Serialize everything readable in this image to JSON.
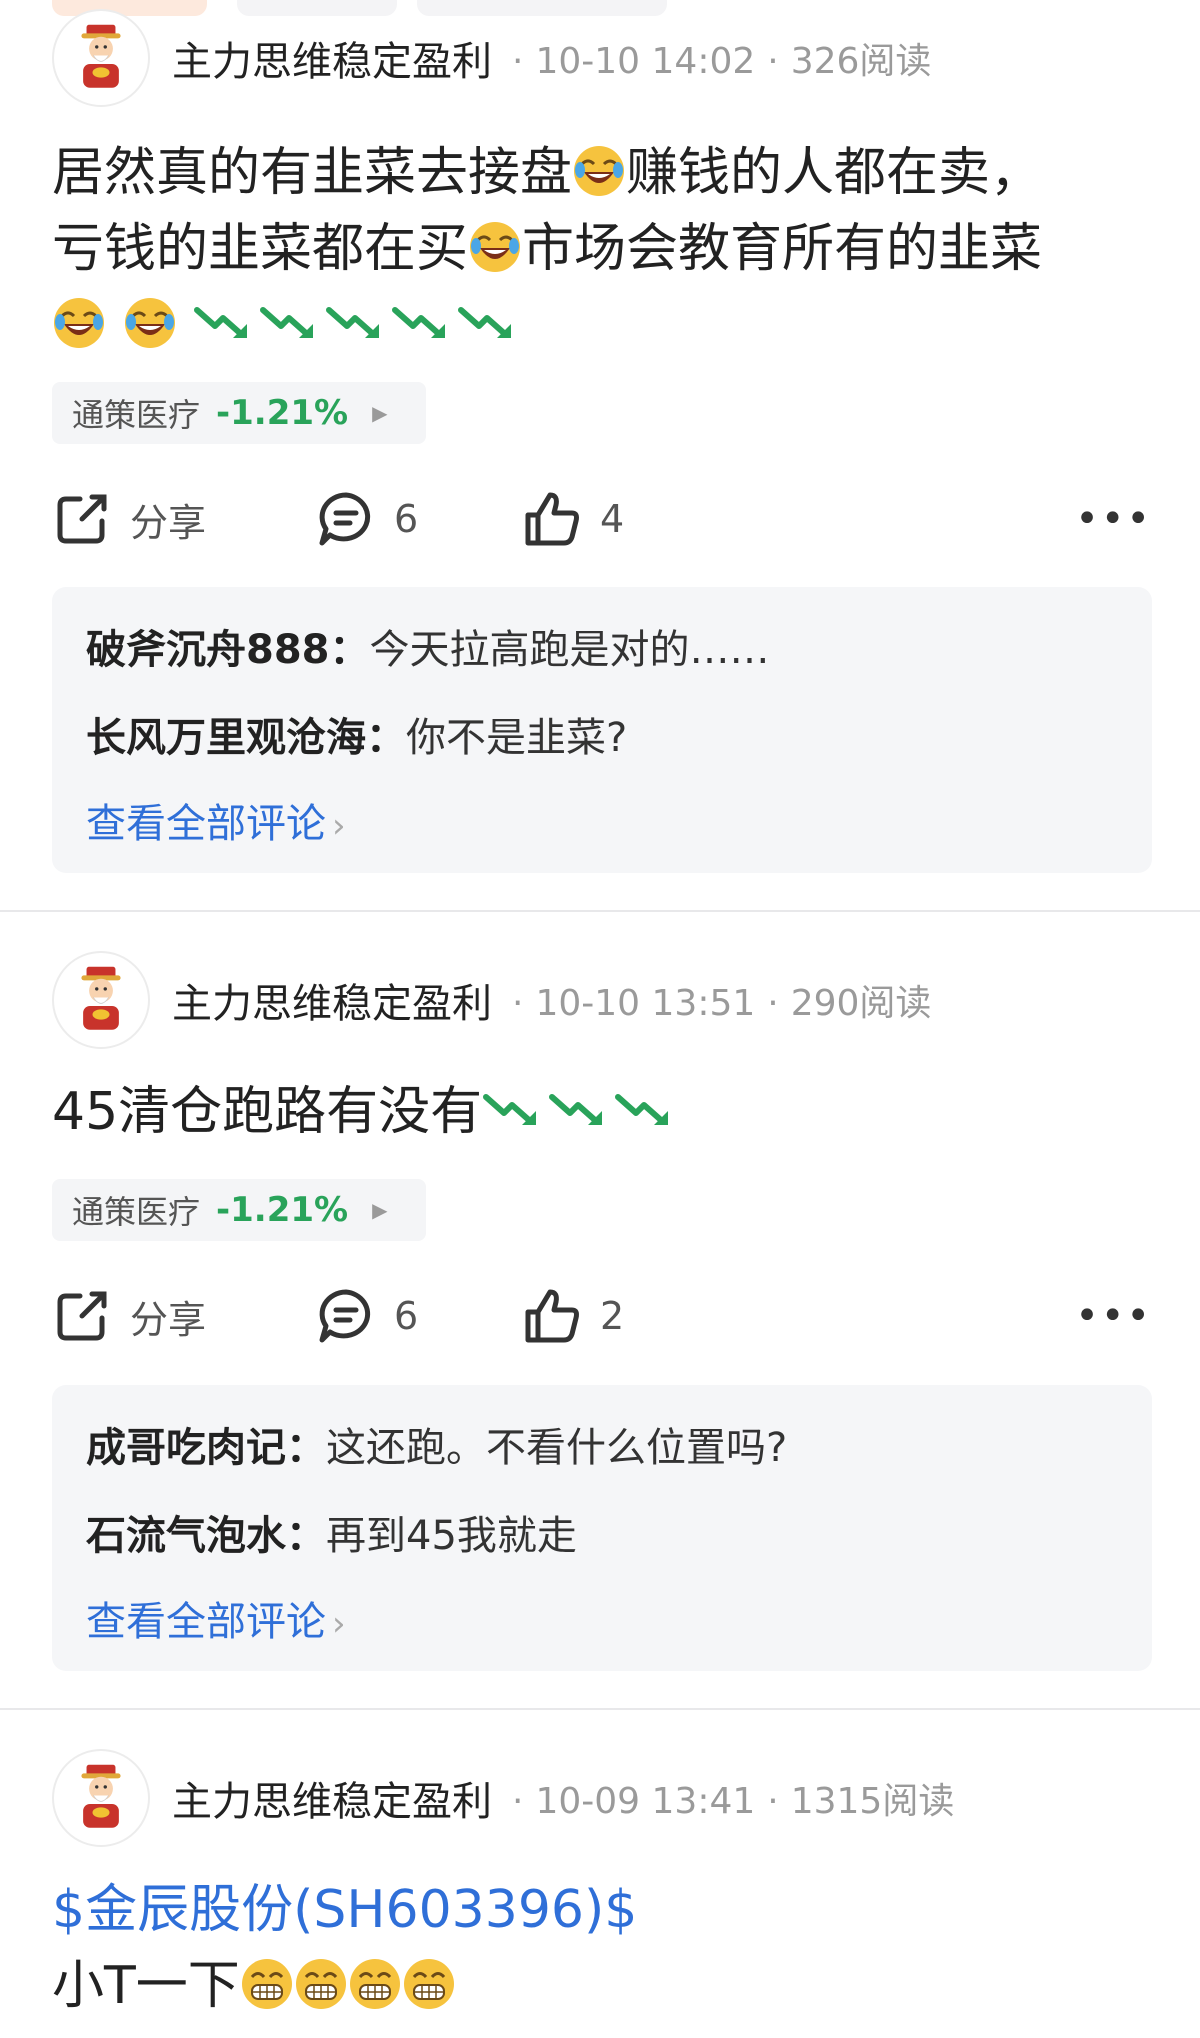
{
  "colors": {
    "link": "#2f6fd8",
    "down": "#29a35a",
    "meta": "#9a9a9a"
  },
  "posts": [
    {
      "author": "主力思维稳定盈利",
      "date": "10-10 14:02",
      "reads": "326阅读",
      "body_parts": [
        "居然真的有韭菜去接盘",
        "赚钱的人都在卖，",
        "亏钱的韭菜都在买",
        "市场会教育所有的韭菜"
      ],
      "stock": {
        "name": "通策医疗",
        "change": "-1.21%"
      },
      "share_label": "分享",
      "comment_count": "6",
      "like_count": "4",
      "comments": [
        {
          "name": "破斧沉舟888",
          "text": "今天拉高跑是对的……"
        },
        {
          "name": "长风万里观沧海",
          "text": "你不是韭菜?"
        }
      ],
      "view_all": "查看全部评论"
    },
    {
      "author": "主力思维稳定盈利",
      "date": "10-10 13:51",
      "reads": "290阅读",
      "body_text": "45清仓跑路有没有",
      "stock": {
        "name": "通策医疗",
        "change": "-1.21%"
      },
      "share_label": "分享",
      "comment_count": "6",
      "like_count": "2",
      "comments": [
        {
          "name": "成哥吃肉记",
          "text": "这还跑。不看什么位置吗?"
        },
        {
          "name": "石流气泡水",
          "text": "再到45我就走"
        }
      ],
      "view_all": "查看全部评论"
    },
    {
      "author": "主力思维稳定盈利",
      "date": "10-09 13:41",
      "reads": "1315阅读",
      "cashtag": "$金辰股份(SH603396)$",
      "body_text": "小T一下"
    }
  ]
}
